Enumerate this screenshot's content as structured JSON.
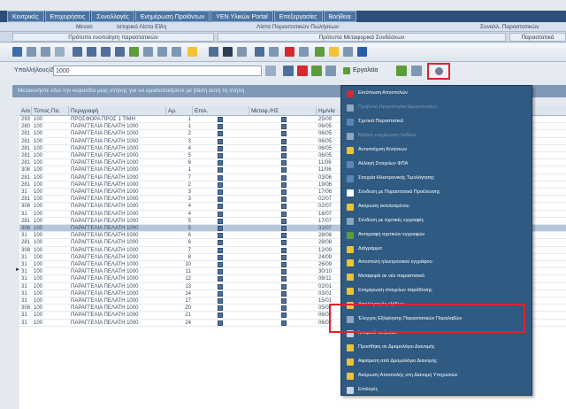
{
  "module_tabs": [
    "Κεντρικές",
    "Επιχειρήσεις",
    "Συναλλαγές",
    "Ενημέρωση Προϊόντων",
    "ΥΕΝ Υλικών Portal",
    "Επεξεργασίες",
    "Βοήθεια"
  ],
  "caption_row": [
    "Μενού",
    "Ιστορικό Λίστα Είδη",
    "Λίστα Παραστατικών Πωλήσεων",
    "Συναλλ. Παραστατικών"
  ],
  "sub_tabs": [
    "Πρότυπο ενοποίηση παραστατικών",
    "Πρότυπα Μεταφορικά Συνδέσεων",
    "Παραστατικά"
  ],
  "search": {
    "label": "Υπαλλήλους/Δρόμος",
    "value": "1000"
  },
  "toolbar": {
    "reports_label": "Εργαλεία"
  },
  "group_bar_text": "Μετακινήστε εδώ την κεφαλίδα μιας στήλης για να ομαδοποιήσετε με βάση αυτή τη στήλη",
  "grid": {
    "columns": [
      "Α/α",
      "Τύπος Πα.",
      "Περιγραφή",
      "Αρ.",
      "Επιλ.",
      "Μεταφ./ΗΣ",
      "Ημ/νία"
    ],
    "rows": [
      {
        "aa": "293",
        "type": "100",
        "desc": "ΠΡΟΣΦΟΡΑ ΠΡΟΣ 1 ΤΙΜΗ",
        "num": "1",
        "date": "25/09"
      },
      {
        "aa": "280",
        "type": "100",
        "desc": "ΠΑΡΑΓΓΕΛΙΑ ΠΕΛΑΤΗ 1000",
        "num": "1",
        "date": "06/05"
      },
      {
        "aa": "281",
        "type": "100",
        "desc": "ΠΑΡΑΓΓΕΛΙΑ ΠΕΛΑΤΗ 1000",
        "num": "2",
        "date": "06/05"
      },
      {
        "aa": "281",
        "type": "100",
        "desc": "ΠΑΡΑΓΓΕΛΙΑ ΠΕΛΑΤΗ 1000",
        "num": "3",
        "date": "06/05"
      },
      {
        "aa": "281",
        "type": "100",
        "desc": "ΠΑΡΑΓΓΕΛΙΑ ΠΕΛΑΤΗ 1000",
        "num": "4",
        "date": "06/05"
      },
      {
        "aa": "281",
        "type": "100",
        "desc": "ΠΑΡΑΓΓΕΛΙΑ ΠΕΛΑΤΗ 1000",
        "num": "5",
        "date": "06/05"
      },
      {
        "aa": "281",
        "type": "100",
        "desc": "ΠΑΡΑΓΓΕΛΙΑ ΠΕΛΑΤΗ 1000",
        "num": "6",
        "date": "11/06"
      },
      {
        "aa": "308",
        "type": "100",
        "desc": "ΠΑΡΑΓΓΕΛΙΑ ΠΕΛΑΤΗ 1000",
        "num": "1",
        "date": "11/06"
      },
      {
        "aa": "281",
        "type": "100",
        "desc": "ΠΑΡΑΓΓΕΛΙΑ ΠΕΛΑΤΗ 1000",
        "num": "7",
        "date": "03/06"
      },
      {
        "aa": "281",
        "type": "100",
        "desc": "ΠΑΡΑΓΓΕΛΙΑ ΠΕΛΑΤΗ 1000",
        "num": "2",
        "date": "19/06"
      },
      {
        "aa": "31",
        "type": "100",
        "desc": "ΠΑΡΑΓΓΕΛΙΑ ΠΕΛΑΤΗ 1000",
        "num": "3",
        "date": "17/06"
      },
      {
        "aa": "281",
        "type": "100",
        "desc": "ΠΑΡΑΓΓΕΛΙΑ ΠΕΛΑΤΗ 1000",
        "num": "3",
        "date": "02/07"
      },
      {
        "aa": "308",
        "type": "100",
        "desc": "ΠΑΡΑΓΓΕΛΙΑ ΠΕΛΑΤΗ 1000",
        "num": "4",
        "date": "02/07"
      },
      {
        "aa": "31",
        "type": "100",
        "desc": "ΠΑΡΑΓΓΕΛΙΑ ΠΕΛΑΤΗ 1000",
        "num": "4",
        "date": "16/07"
      },
      {
        "aa": "281",
        "type": "100",
        "desc": "ΠΑΡΑΓΓΕΛΙΑ ΠΕΛΑΤΗ 1000",
        "num": "5",
        "date": "17/07"
      },
      {
        "aa": "308",
        "type": "100",
        "desc": "ΠΑΡΑΓΓΕΛΙΑ ΠΕΛΑΤΗ 1000",
        "num": "5",
        "date": "31/07",
        "selected": true
      },
      {
        "aa": "31",
        "type": "100",
        "desc": "ΠΑΡΑΓΓΕΛΙΑ ΠΕΛΑΤΗ 1000",
        "num": "6",
        "date": "28/08"
      },
      {
        "aa": "281",
        "type": "100",
        "desc": "ΠΑΡΑΓΓΕΛΙΑ ΠΕΛΑΤΗ 1000",
        "num": "6",
        "date": "28/08"
      },
      {
        "aa": "308",
        "type": "100",
        "desc": "ΠΑΡΑΓΓΕΛΙΑ ΠΕΛΑΤΗ 1000",
        "num": "7",
        "date": "12/09"
      },
      {
        "aa": "31",
        "type": "100",
        "desc": "ΠΑΡΑΓΓΕΛΙΑ ΠΕΛΑΤΗ 1000",
        "num": "8",
        "date": "24/09"
      },
      {
        "aa": "31",
        "type": "100",
        "desc": "ΠΑΡΑΓΓΕΛΙΑ ΠΕΛΑΤΗ 1000",
        "num": "10",
        "date": "26/09"
      },
      {
        "aa": "31",
        "type": "100",
        "desc": "ΠΑΡΑΓΓΕΛΙΑ ΠΕΛΑΤΗ 1000",
        "num": "11",
        "date": "30/10"
      },
      {
        "aa": "31",
        "type": "100",
        "desc": "ΠΑΡΑΓΓΕΛΙΑ ΠΕΛΑΤΗ 1000",
        "num": "12",
        "date": "08/11"
      },
      {
        "aa": "31",
        "type": "100",
        "desc": "ΠΑΡΑΓΓΕΛΙΑ ΠΕΛΑΤΗ 1000",
        "num": "13",
        "date": "02/01"
      },
      {
        "aa": "31",
        "type": "100",
        "desc": "ΠΑΡΑΓΓΕΛΙΑ ΠΕΛΑΤΗ 1000",
        "num": "14",
        "date": "03/01"
      },
      {
        "aa": "31",
        "type": "100",
        "desc": "ΠΑΡΑΓΓΕΛΙΑ ΠΕΛΑΤΗ 1000",
        "num": "17",
        "date": "15/01"
      },
      {
        "aa": "308",
        "type": "100",
        "desc": "ΠΑΡΑΓΓΕΛΙΑ ΠΕΛΑΤΗ 1000",
        "num": "20",
        "date": "05/02"
      },
      {
        "aa": "31",
        "type": "100",
        "desc": "ΠΑΡΑΓΓΕΛΙΑ ΠΕΛΑΤΗ 1000",
        "num": "21",
        "date": "06/02"
      },
      {
        "aa": "31",
        "type": "100",
        "desc": "ΠΑΡΑΓΓΕΛΙΑ ΠΕΛΑΤΗ 1000",
        "num": "24",
        "date": "06/02"
      }
    ]
  },
  "tools_menu": {
    "items": [
      {
        "label": "Εκτύπωση Αποστολών",
        "icon_color": "#d8292f",
        "dim": false
      },
      {
        "label": "Προβολή Ημερολογίου Δρομολογίων",
        "icon_color": "#8fa6bf",
        "dim": true
      },
      {
        "label": "Σχετικά Παραστατικά",
        "icon_color": "#5b86b6",
        "dim": false
      },
      {
        "label": "Μαζική ενημέρωση πεδίων",
        "icon_color": "#8fa6bf",
        "dim": true
      },
      {
        "label": "Αντιστοίχιση Κινήσεων",
        "icon_color": "#f1c232",
        "dim": false
      },
      {
        "label": "Αλλαγή Στοιχείων ΦΠΑ",
        "icon_color": "#5b86b6",
        "dim": false
      },
      {
        "label": "Στοιχεία Ηλεκτρονικής Τιμολόγησης",
        "icon_color": "#5b86b6",
        "dim": false
      },
      {
        "label": "Σύνδεση με Παραστατικά Προέλευσης",
        "icon_color": "#ffffff",
        "dim": false
      },
      {
        "label": "Ακύρωση εκτελεσμένου",
        "icon_color": "#f1c232",
        "dim": false
      },
      {
        "label": "Σύνδεση με σχετικές εγγραφές",
        "icon_color": "#8fa6bf",
        "dim": false
      },
      {
        "label": "Αντιγραφή σχετικών εγγραφών",
        "icon_color": "#5d9c3a",
        "dim": false
      },
      {
        "label": "Διάγραμμα",
        "icon_color": "#f1c232",
        "dim": false
      },
      {
        "label": "Αποστολή ηλεκτρονικού εγγράφου",
        "icon_color": "#f1c232",
        "dim": false
      },
      {
        "label": "Μεταφορά σε νέο παραστατικό",
        "icon_color": "#f1c232",
        "dim": false
      },
      {
        "label": "Ενημέρωση στοιχείων παράδοσης",
        "icon_color": "#f1c232",
        "dim": false
      },
      {
        "label": "Υπολογισμός εξόδων",
        "icon_color": "#f1c232",
        "dim": false
      },
      {
        "label": "Έλεγχος Εξόφλησης Παραστατικών Παραλαβών",
        "icon_color": "#8fa6bf",
        "dim": false
      },
      {
        "label": "Ιστορικό κινήσεων",
        "icon_color": "#c7d2de",
        "dim": false
      },
      {
        "label": "Προσθήκη σε Δρομολόγιο Διανομής",
        "icon_color": "#f1c232",
        "dim": false
      },
      {
        "label": "Αφαίρεση από Δρομολόγιο Διανομής",
        "icon_color": "#f1c232",
        "dim": false
      },
      {
        "label": "Ακύρωση Αποστολής στη Διανομή Υπηρεσιών",
        "icon_color": "#f1c232",
        "dim": false
      },
      {
        "label": "Επιλογές",
        "icon_color": "#c7d2de",
        "dim": false
      }
    ]
  },
  "colors": {
    "menu_bg": "#2f5a81",
    "highlight_box": "#e5202b",
    "module_bar": "#2c4f7a",
    "selected_row": "#b7c7da"
  }
}
